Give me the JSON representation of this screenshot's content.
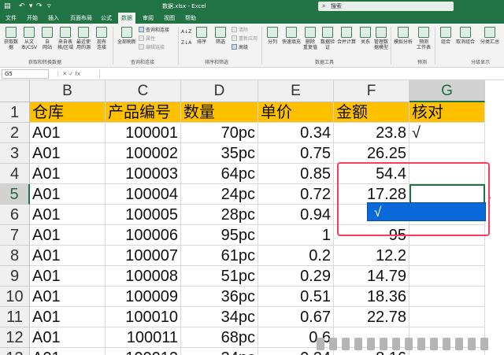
{
  "app": {
    "title": "数据.xlsx  -  Excel",
    "search_placeholder": "搜索",
    "accent": "#217346"
  },
  "tabs": [
    "文件",
    "开始",
    "插入",
    "页面布局",
    "公式",
    "数据",
    "审阅",
    "视图",
    "帮助"
  ],
  "active_tab": "数据",
  "ribbon": {
    "get_data": [
      "获取数",
      "据"
    ],
    "from_csv": [
      "从文",
      "本/CSV"
    ],
    "from_web": [
      "自",
      "网站"
    ],
    "from_table": [
      "来自表",
      "格/区域"
    ],
    "recent_sources": [
      "最近使",
      "用的源"
    ],
    "existing_conn": [
      "现有",
      "连接"
    ],
    "refresh_all": [
      "全部刷新"
    ],
    "queries_connections": "查询和连接",
    "properties": "属性",
    "edit_links": "编辑链接",
    "sort_asc": "A↓Z",
    "sort_desc": "Z↓A",
    "sort": "排序",
    "filter": "筛选",
    "clear": "清除",
    "reapply": "重新应用",
    "advanced": "高级",
    "text_to_columns": "分列",
    "flash_fill": "快速填充",
    "remove_dupes": [
      "删除",
      "重复值"
    ],
    "data_validation": [
      "数据验",
      "证"
    ],
    "consolidate": "合并计算",
    "relationships": "关系",
    "data_model": [
      "管理数",
      "据模型"
    ],
    "what_if": "模拟分析",
    "forecast": [
      "预测",
      "工作表"
    ],
    "group": "组合",
    "ungroup": "取消组合",
    "subtotal": "分类汇总",
    "group_get_data": "获取和转换数据",
    "group_queries": "查询和连接",
    "group_sort_filter": "排序和筛选",
    "group_data_tools": "数据工具",
    "group_forecast": "预测",
    "group_outline": "分级显示"
  },
  "formula_bar": {
    "name_box": "G5",
    "fx_icons": "⋮   ✕   ✓   fx",
    "formula": ""
  },
  "columns": [
    "B",
    "C",
    "D",
    "E",
    "F",
    "G"
  ],
  "rows": [
    "1",
    "2",
    "3",
    "4",
    "5",
    "6",
    "7",
    "8",
    "9",
    "10",
    "11",
    "12",
    "13"
  ],
  "table": [
    [
      "仓库",
      "产品编号",
      "数量",
      "单价",
      "金额",
      "核对"
    ],
    [
      "A01",
      "100001",
      "70pc",
      "0.34",
      "23.8",
      "√"
    ],
    [
      "A01",
      "100002",
      "35pc",
      "0.75",
      "26.25",
      ""
    ],
    [
      "A01",
      "100003",
      "64pc",
      "0.85",
      "54.4",
      ""
    ],
    [
      "A01",
      "100004",
      "24pc",
      "0.72",
      "17.28",
      ""
    ],
    [
      "A01",
      "100005",
      "28pc",
      "0.94",
      "",
      ""
    ],
    [
      "A01",
      "100006",
      "95pc",
      "1",
      "95",
      ""
    ],
    [
      "A01",
      "100007",
      "61pc",
      "0.2",
      "12.2",
      ""
    ],
    [
      "A01",
      "100008",
      "51pc",
      "0.29",
      "14.79",
      ""
    ],
    [
      "A01",
      "100009",
      "36pc",
      "0.51",
      "18.36",
      ""
    ],
    [
      "A01",
      "100010",
      "34pc",
      "0.67",
      "22.78",
      ""
    ],
    [
      "A01",
      "100011",
      "68pc",
      "0.6",
      "",
      ""
    ],
    [
      "A01",
      "100012",
      "34pc",
      "0.24",
      "8.16",
      ""
    ]
  ],
  "dropdown_option": "√",
  "header_fill": "#ffc000",
  "annotation_color": "#ff3b5c",
  "dropdown_color": "#0a68d8"
}
